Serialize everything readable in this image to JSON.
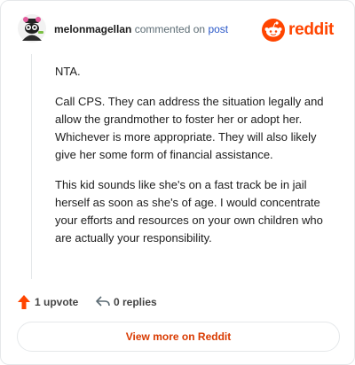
{
  "header": {
    "username": "melonmagellan",
    "action_text": "commented on",
    "post_link": "post",
    "brand": "reddit"
  },
  "comment": {
    "paragraphs": [
      "NTA.",
      "Call CPS. They can address the situation legally and allow the grandmother to foster her or adopt her. Whichever is more appropriate. They will also likely give her some form of financial assistance.",
      "This kid sounds like she's on a fast track be in jail herself as soon as she's of age. I would concentrate your efforts and resources on your own children who are actually your responsibility."
    ]
  },
  "actions": {
    "upvotes": "1 upvote",
    "replies": "0 replies"
  },
  "footer": {
    "view_more": "View more on Reddit"
  },
  "colors": {
    "brand": "#ff4500",
    "link": "#2a58c8",
    "button_text": "#d93a00"
  }
}
